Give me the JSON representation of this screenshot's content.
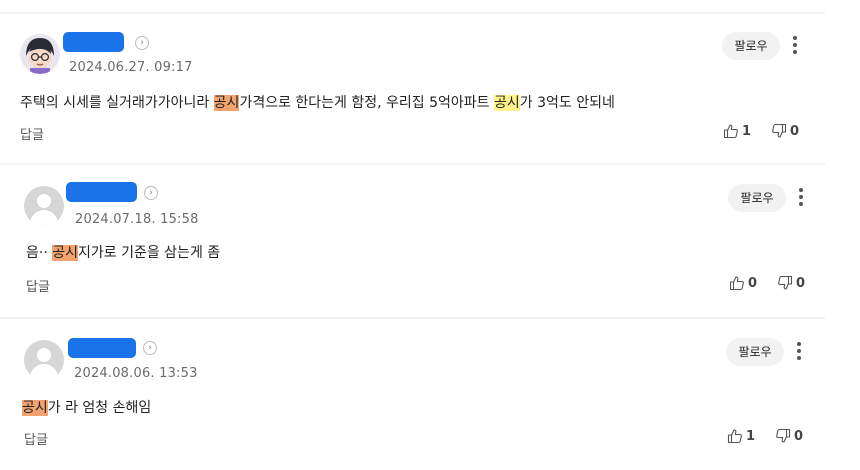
{
  "comments": [
    {
      "date": "2024.06.27. 09:17",
      "text_parts": [
        {
          "t": "주택의 시세를 실거래가가아니라 "
        },
        {
          "t": "공시",
          "hl": "orange"
        },
        {
          "t": "가격으로 한다는게 함정, 우리집 5억아파트 "
        },
        {
          "t": "공시",
          "hl": "yellow"
        },
        {
          "t": "가 3억도 안되네"
        }
      ],
      "reply_label": "답글",
      "follow_label": "팔로우",
      "likes": "1",
      "dislikes": "0"
    },
    {
      "date": "2024.07.18. 15:58",
      "text_parts": [
        {
          "t": "음·· "
        },
        {
          "t": "공시",
          "hl": "orange"
        },
        {
          "t": "지가로 기준을 삼는게 좀"
        }
      ],
      "reply_label": "답글",
      "follow_label": "팔로우",
      "likes": "0",
      "dislikes": "0"
    },
    {
      "date": "2024.08.06. 13:53",
      "text_parts": [
        {
          "t": "공시",
          "hl": "orange"
        },
        {
          "t": "가 라 엄청 손해임"
        }
      ],
      "reply_label": "답글",
      "follow_label": "팔로우",
      "likes": "1",
      "dislikes": "0"
    }
  ],
  "icons": {
    "like": "thumbs-up-icon",
    "dislike": "thumbs-down-icon",
    "more": "more-vertical-icon",
    "chevron": "chevron-right-icon"
  },
  "colors": {
    "name_mask": "#1a73e8",
    "highlight_orange": "#f2a36f",
    "highlight_yellow": "#fff38a"
  }
}
